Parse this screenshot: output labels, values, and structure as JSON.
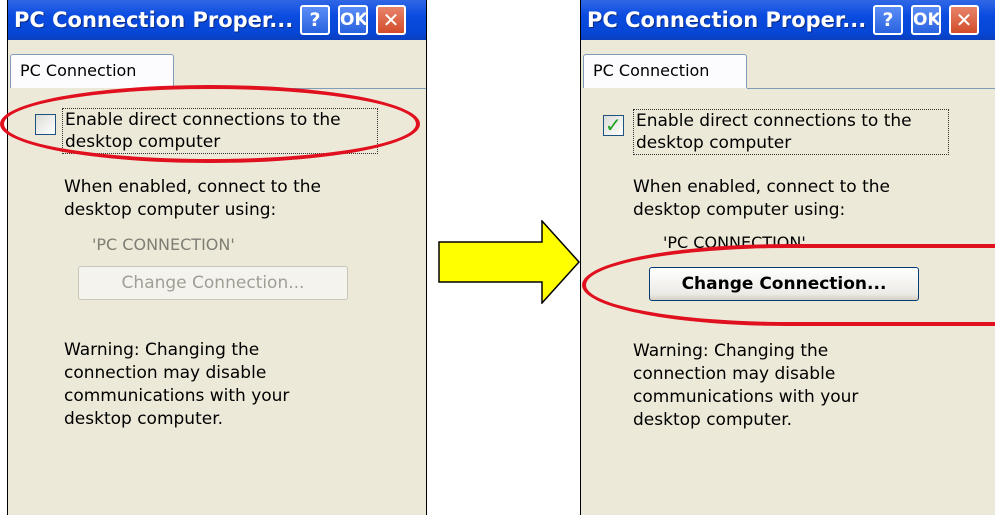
{
  "colors": {
    "titlebar": "#0a4be0",
    "window_bg": "#ece9d8",
    "annotation_red": "#e0101e",
    "arrow_yellow": "#ffff00",
    "check_green": "#21a121",
    "disabled_text": "#a19f94"
  },
  "windows": [
    {
      "title": "PC Connection Proper...",
      "help_label": "?",
      "ok_label": "OK",
      "close_icon": "close-icon",
      "tab_label": "PC Connection",
      "checkbox_checked": false,
      "checkbox_label": "Enable direct connections to the\ndesktop computer",
      "info_text": "When enabled, connect to the\ndesktop computer using:",
      "connection_name": "'PC CONNECTION'",
      "change_button_label": "Change Connection...",
      "change_button_enabled": false,
      "warning_text": "Warning: Changing the\nconnection may disable\ncommunications with your\ndesktop computer."
    },
    {
      "title": "PC Connection Proper...",
      "help_label": "?",
      "ok_label": "OK",
      "close_icon": "close-icon",
      "tab_label": "PC Connection",
      "checkbox_checked": true,
      "checkbox_label": "Enable direct connections to the\ndesktop computer",
      "info_text": "When enabled, connect to the\ndesktop computer using:",
      "connection_name": "'PC CONNECTION'",
      "change_button_label": "Change Connection...",
      "change_button_enabled": true,
      "warning_text": "Warning: Changing the\nconnection may disable\ncommunications with your\ndesktop computer."
    }
  ],
  "annotations": {
    "arrow_icon": "right-arrow-icon",
    "left_highlight": "checkbox",
    "right_highlight": "change-button"
  }
}
